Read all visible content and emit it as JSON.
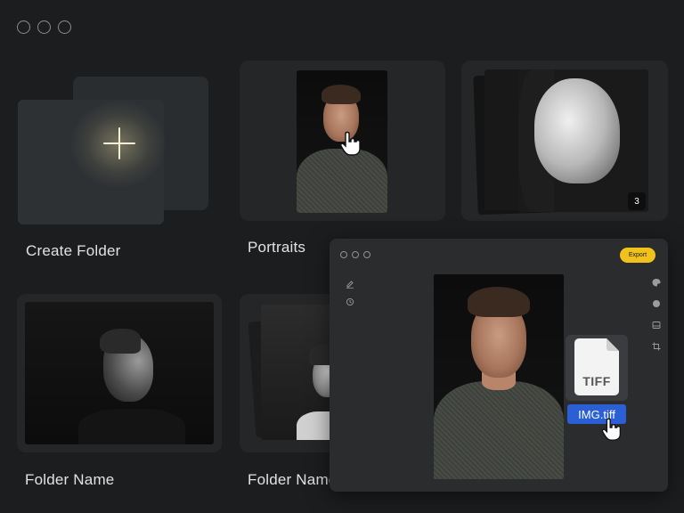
{
  "window": {
    "controls": [
      "close",
      "minimize",
      "maximize"
    ]
  },
  "cards": [
    {
      "label": "Create Folder"
    },
    {
      "label": "Portraits"
    },
    {
      "label": "",
      "count": "3"
    },
    {
      "label": "Folder Name"
    },
    {
      "label": "Folder Name"
    }
  ],
  "editor": {
    "export_label": "Export",
    "file_type": "TIFF",
    "file_name": "IMG.tiff",
    "left_tools": [
      "pen-icon",
      "history-icon"
    ],
    "right_tools": [
      "palette-icon",
      "droplet-icon",
      "layers-icon",
      "crop-icon"
    ]
  },
  "colors": {
    "background": "#1b1d1f",
    "card": "#242628",
    "accent": "#f1c21b",
    "selection": "#2a5fd6"
  }
}
